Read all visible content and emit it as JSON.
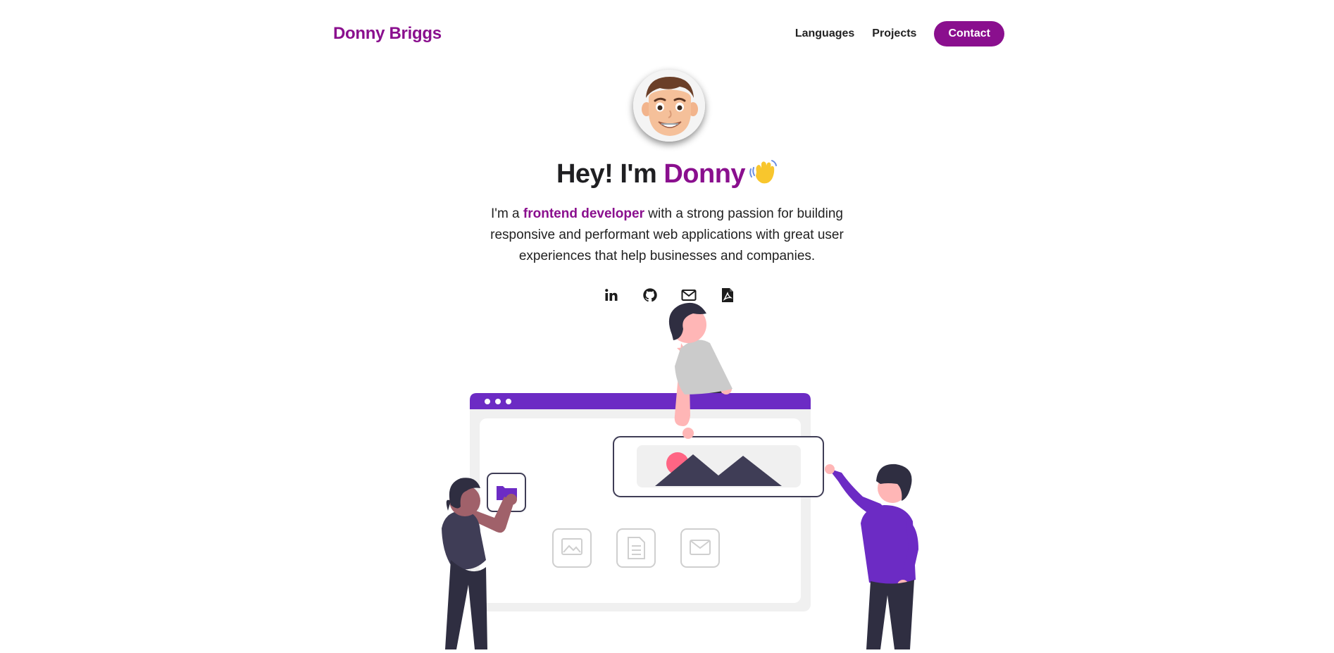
{
  "header": {
    "brand": "Donny Briggs",
    "nav": {
      "languages": "Languages",
      "projects": "Projects",
      "contact": "Contact"
    }
  },
  "hero": {
    "headline_prefix": "Hey! I'm ",
    "headline_name": "Donny",
    "intro_before": "I'm a ",
    "intro_highlight": "frontend developer",
    "intro_after": " with a strong passion for building responsive and performant web applications with great user experiences that help businesses and companies."
  },
  "socials": [
    {
      "icon": "linkedin-icon"
    },
    {
      "icon": "github-icon"
    },
    {
      "icon": "mail-icon"
    },
    {
      "icon": "pdf-icon"
    }
  ],
  "colors": {
    "accent": "#8a0f8e",
    "illustration_purple": "#6c2bc4",
    "dark": "#2f2e41"
  }
}
